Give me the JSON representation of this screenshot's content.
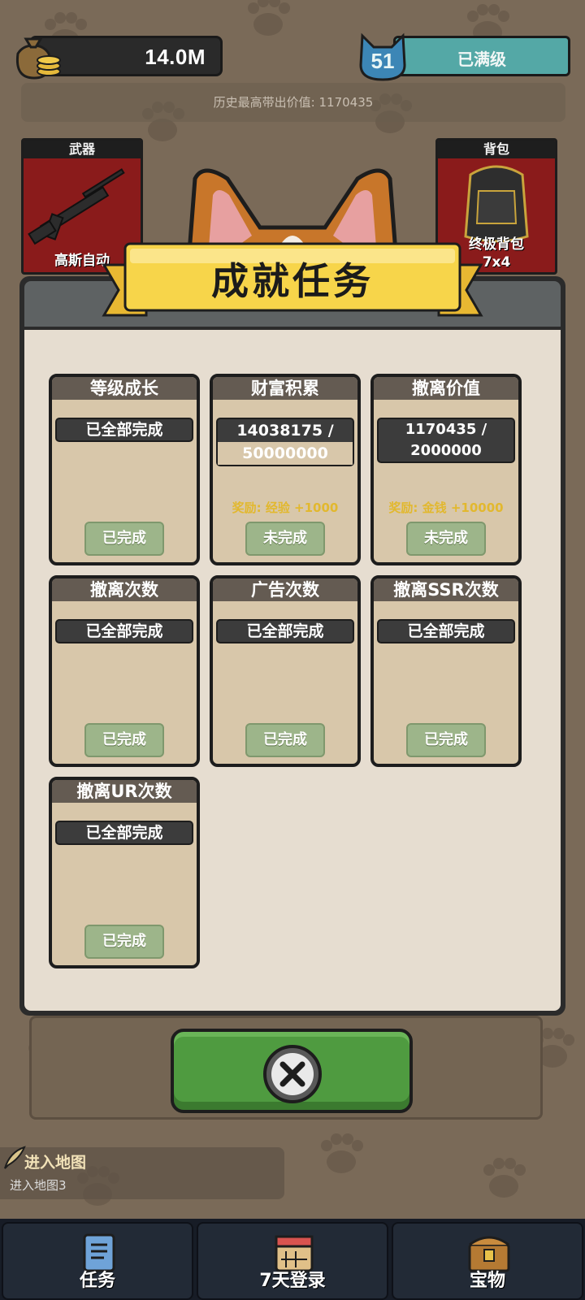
{
  "hud": {
    "coins": "14.0M",
    "level": "51",
    "level_status": "已满级",
    "history_best": "历史最高带出价值: 1170435"
  },
  "equipment": {
    "weapon": {
      "header": "武器",
      "name": "高斯自动"
    },
    "backpack": {
      "header": "背包",
      "name": "终极背包",
      "size": "7x4"
    }
  },
  "modal": {
    "title": "成就任务",
    "achievements": [
      {
        "name": "等级成长",
        "progress": "已全部完成",
        "reward": "",
        "button": "已完成"
      },
      {
        "name": "财富积累",
        "progress_line1": "14038175 /",
        "progress_line2": "50000000",
        "reward": "奖励: 经验 +1000",
        "button": "未完成"
      },
      {
        "name": "撤离价值",
        "progress": "1170435 / 2000000",
        "reward": "奖励: 金钱 +10000",
        "button": "未完成"
      },
      {
        "name": "撤离次数",
        "progress": "已全部完成",
        "reward": "",
        "button": "已完成"
      },
      {
        "name": "广告次数",
        "progress": "已全部完成",
        "reward": "",
        "button": "已完成"
      },
      {
        "name": "撤离SSR次数",
        "progress": "已全部完成",
        "reward": "",
        "button": "已完成"
      },
      {
        "name": "撤离UR次数",
        "progress": "已全部完成",
        "reward": "",
        "button": "已完成"
      }
    ]
  },
  "map_hint": {
    "title": "进入地图",
    "subtitle": "进入地图3"
  },
  "nav": [
    {
      "label": "任务",
      "icon": "scroll-icon"
    },
    {
      "label": "7天登录",
      "icon": "calendar-icon"
    },
    {
      "label": "宝物",
      "icon": "treasure-chest-icon"
    }
  ],
  "colors": {
    "accent_green": "#4f9b40",
    "ribbon_yellow": "#f7d54a",
    "reward_gold": "#e2b82e",
    "level_teal": "#54a8a6"
  }
}
